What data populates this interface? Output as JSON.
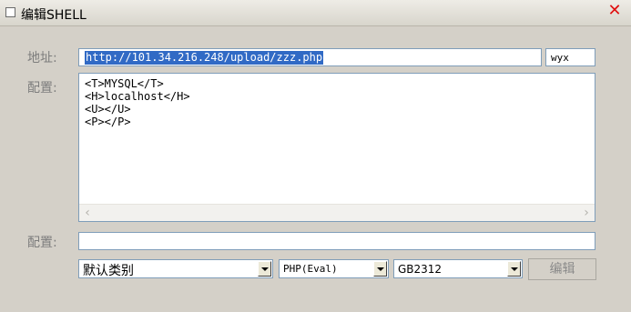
{
  "window": {
    "title": "编辑SHELL",
    "close_glyph": "✕"
  },
  "form": {
    "address_label": "地址:",
    "address_value": "http://101.34.216.248/upload/zzz.php",
    "password_value": "wyx",
    "config_label": "配置:",
    "config_value": "<T>MYSQL</T>\n<H>localhost</H>\n<U></U>\n<P></P>",
    "config2_label": "配置:",
    "config2_value": ""
  },
  "options": {
    "category_selected": "默认类别",
    "type_selected": "PHP(Eval)",
    "encoding_selected": "GB2312"
  },
  "actions": {
    "edit_label": "编辑"
  },
  "icons": {
    "window": "window-icon",
    "close": "close-icon",
    "scroll_left": "scroll-left-icon",
    "scroll_right": "scroll-right-icon",
    "dropdown": "chevron-down-icon"
  },
  "colors": {
    "close": "#e01010",
    "selection": "#316ac5",
    "background": "#d4d0c8"
  }
}
